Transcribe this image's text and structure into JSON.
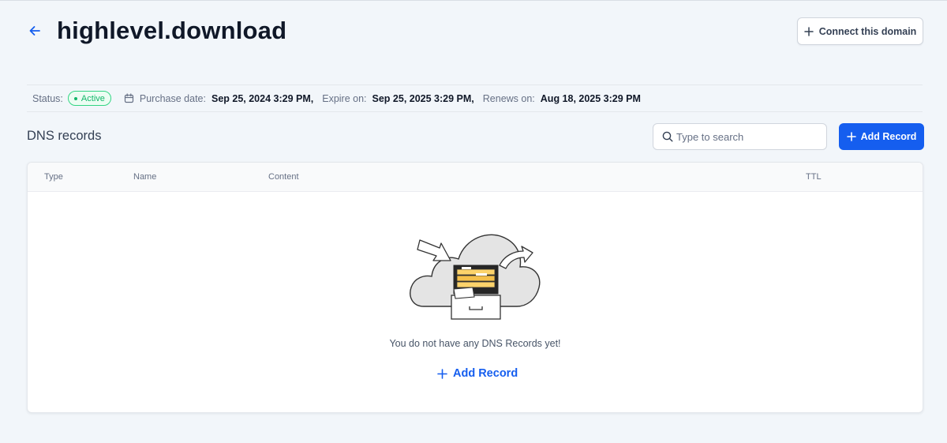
{
  "header": {
    "title": "highlevel.download",
    "connect_label": "Connect this domain"
  },
  "status_bar": {
    "status_label": "Status:",
    "status_value": "Active",
    "purchase_label": "Purchase date:",
    "purchase_value": "Sep 25, 2024 3:29 PM,",
    "expire_label": "Expire on:",
    "expire_value": "Sep 25, 2025 3:29 PM,",
    "renew_label": "Renews on:",
    "renew_value": "Aug 18, 2025 3:29 PM"
  },
  "dns": {
    "title": "DNS records",
    "search_placeholder": "Type to search",
    "add_label": "Add Record",
    "columns": [
      "Type",
      "Name",
      "Content",
      "TTL"
    ],
    "empty_message": "You do not have any DNS Records yet!",
    "empty_add_label": "Add Record"
  },
  "colors": {
    "accent": "#155eef",
    "status_active": "#12b76a",
    "background": "#f2f6fa"
  }
}
